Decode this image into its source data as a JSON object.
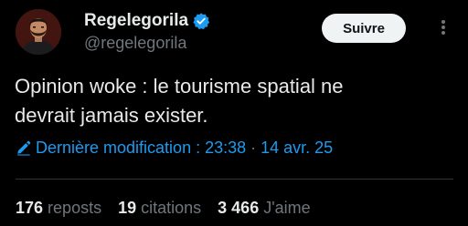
{
  "user": {
    "display_name": "Regelegorila",
    "handle": "@regelegorila",
    "verified": true,
    "avatar_icon": "avatar-icon"
  },
  "follow_button": {
    "label": "Suivre"
  },
  "more_icon": "more-dots-icon",
  "tweet": {
    "text": "Opinion woke : le tourisme spatial ne\ndevrait jamais exister."
  },
  "meta": {
    "edited_label": "Dernière modification : 23:38",
    "separator": "·",
    "date": "14 avr. 25",
    "pencil_icon": "pencil-icon"
  },
  "stats": [
    {
      "count": "176",
      "label": "reposts"
    },
    {
      "count": "19",
      "label": "citations"
    },
    {
      "count": "3 466",
      "label": "J'aime"
    }
  ],
  "colors": {
    "background": "#000000",
    "text": "#e7e9ea",
    "secondary": "#71767b",
    "accent": "#1d9bf0",
    "button_bg": "#eff3f4",
    "divider": "#2f3336"
  }
}
